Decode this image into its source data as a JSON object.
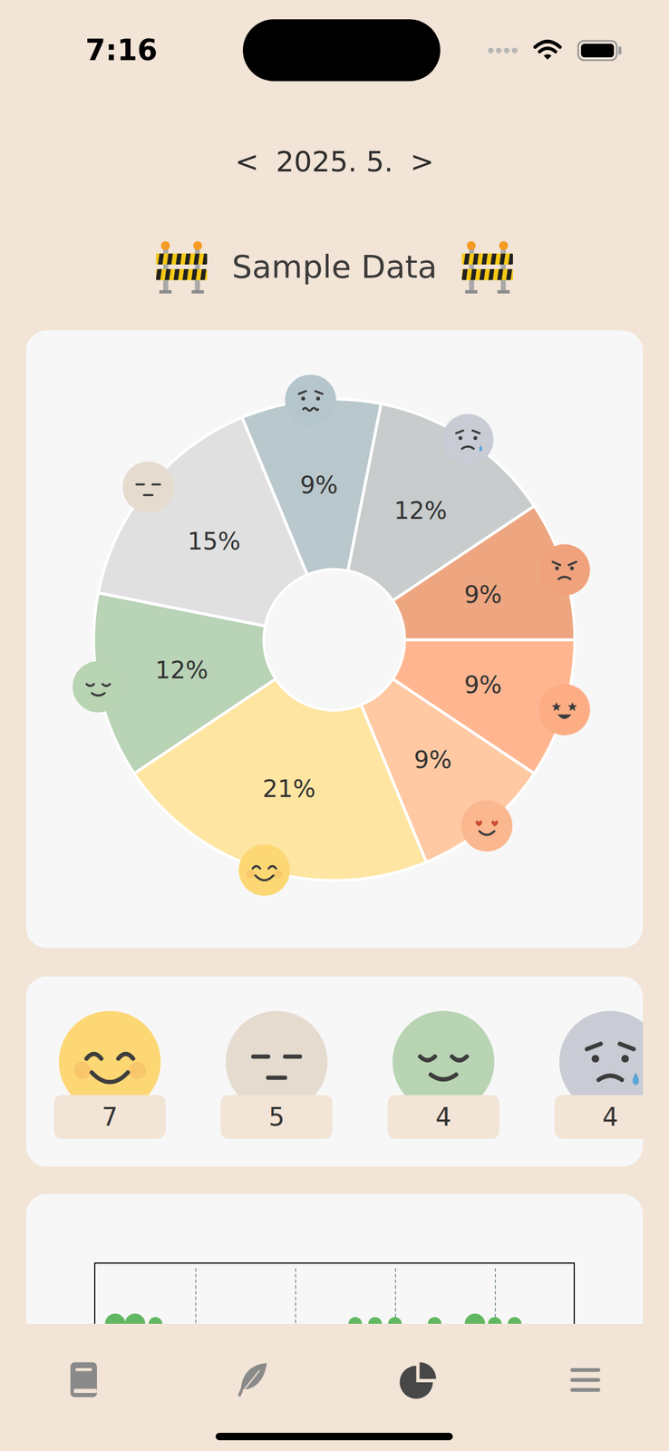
{
  "status_bar": {
    "time": "7:16",
    "battery": {
      "level": 1
    }
  },
  "month_nav": {
    "prev": "<",
    "label": "2025. 5.",
    "next": ">"
  },
  "banner": {
    "text": "Sample Data"
  },
  "chart": {
    "segments": [
      {
        "kind": "excited",
        "value": 3,
        "label": "9%",
        "color": "#ffb690"
      },
      {
        "kind": "love",
        "value": 3,
        "label": "9%",
        "color": "#ffc9a3"
      },
      {
        "kind": "happy",
        "value": 7,
        "label": "21%",
        "color": "#fee5a1"
      },
      {
        "kind": "calm",
        "value": 4,
        "label": "12%",
        "color": "#b9d3b6"
      },
      {
        "kind": "neutral",
        "value": 5,
        "label": "15%",
        "color": "#e0e0e0"
      },
      {
        "kind": "worried",
        "value": 3,
        "label": "9%",
        "color": "#b9c8cd"
      },
      {
        "kind": "sad",
        "value": 4,
        "label": "12%",
        "color": "#c8cccd"
      },
      {
        "kind": "angry",
        "value": 3,
        "label": "9%",
        "color": "#eda680"
      }
    ]
  },
  "mood_counts": [
    {
      "kind": "happy",
      "count": "7"
    },
    {
      "kind": "neutral",
      "count": "5"
    },
    {
      "kind": "calm",
      "count": "4"
    },
    {
      "kind": "sad",
      "count": "4"
    }
  ],
  "timeline": {
    "days": [
      1,
      2,
      3,
      13,
      14,
      15,
      17,
      19,
      20,
      21
    ],
    "counts": [
      2,
      2,
      1,
      1,
      1,
      1,
      1,
      2,
      1,
      1
    ],
    "color": "#62b862"
  },
  "tabs": [
    {
      "kind": "diary",
      "selected": false
    },
    {
      "kind": "write",
      "selected": false
    },
    {
      "kind": "stats",
      "selected": true
    },
    {
      "kind": "menu",
      "selected": false
    }
  ]
}
